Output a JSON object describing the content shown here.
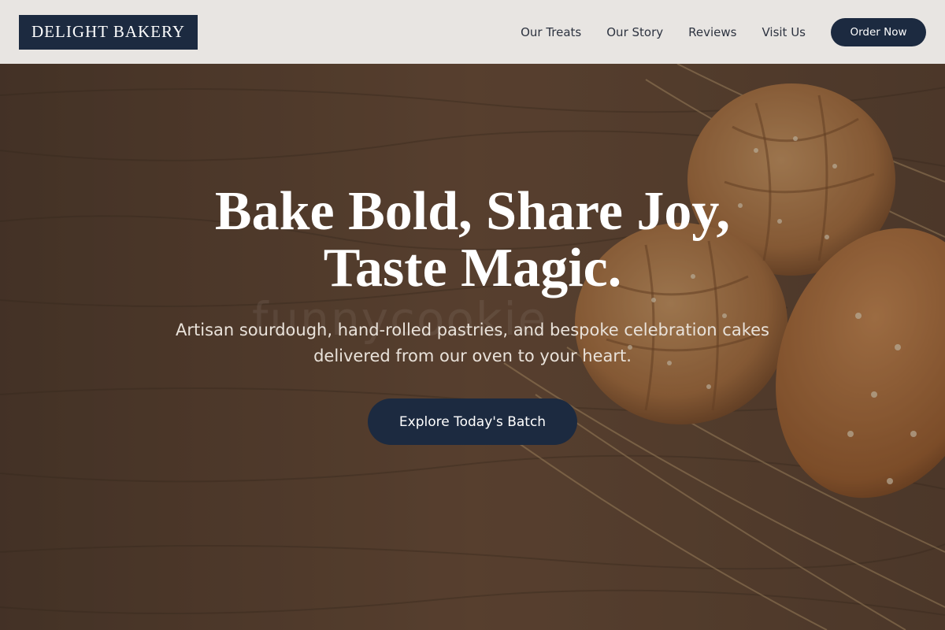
{
  "brand": {
    "name": "DELIGHT BAKERY"
  },
  "nav": {
    "links": [
      "Our Treats",
      "Our Story",
      "Reviews",
      "Visit Us"
    ],
    "cta_label": "Order Now"
  },
  "hero": {
    "headline_line1": "Bake Bold, Share Joy,",
    "headline_line2": "Taste Magic.",
    "subtext_line1": "Artisan sourdough, hand-rolled pastries, and bespoke celebration cakes",
    "subtext_line2": "delivered from our oven to your heart.",
    "cta_label": "Explore Today's Batch",
    "watermark": "funnycookie"
  },
  "colors": {
    "navy": "#1c2a40",
    "nav_bg": "#e8e5e2",
    "wood": "#5a4332",
    "bread": "#b07a45"
  }
}
